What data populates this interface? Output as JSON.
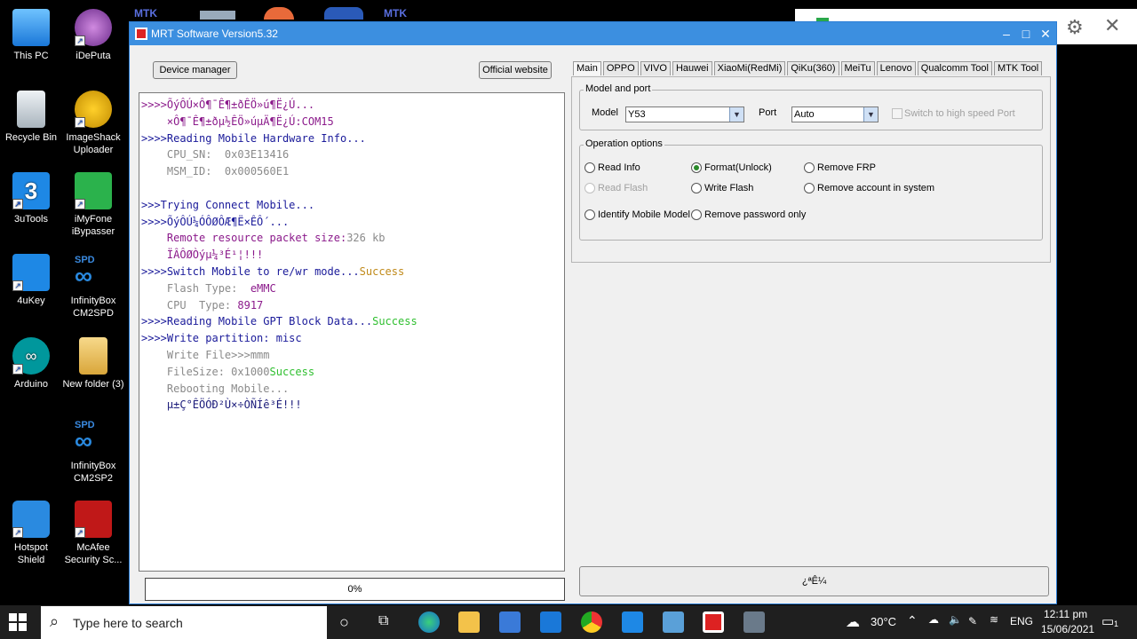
{
  "desktop": {
    "icons": [
      {
        "label": "This PC"
      },
      {
        "label": "iDePuta"
      },
      {
        "label": "Recycle Bin"
      },
      {
        "label": "ImageShack Uploader"
      },
      {
        "label": "3uTools"
      },
      {
        "label": "iMyFone iBypasser"
      },
      {
        "label": "4uKey"
      },
      {
        "label": "InfinityBox CM2SPD"
      },
      {
        "label": "Arduino"
      },
      {
        "label": "New folder (3)"
      },
      {
        "label": "InfinityBox CM2SP2"
      },
      {
        "label": "Hotspot Shield"
      },
      {
        "label": "McAfee Security Sc..."
      }
    ],
    "top_labels": [
      "MTK",
      "MTK"
    ],
    "spd_labels": [
      "SPD",
      "SPD"
    ]
  },
  "window": {
    "title": "MRT Software Version5.32",
    "device_manager_label": "Device manager",
    "official_website_label": "Official website",
    "progress_text": "0%",
    "bottom_button_text": "¿ªÊ¼"
  },
  "log": {
    "lines": [
      {
        "text": ">>>>ÕýÔÚ×Ô¶¯Ê¶±ðÊÖ»ú¶Ë¿Ú...",
        "cls": "c-purple"
      },
      {
        "text": "    ×Ô¶¯Ê¶±ðµ½ÊÖ»úµÄ¶Ë¿Ú:COM15",
        "cls": "c-purple"
      },
      {
        "text": ">>>>Reading Mobile Hardware Info...",
        "cls": "c-blue"
      },
      {
        "text": "    CPU_SN:  0x03E13416",
        "cls": "c-gray"
      },
      {
        "text": "    MSM_ID:  0x000560E1",
        "cls": "c-gray"
      },
      {
        "text": "",
        "cls": "c-gray"
      },
      {
        "text": ">>>Trying Connect Mobile...",
        "cls": "c-blue"
      },
      {
        "text": ">>>>ÕýÔÚ¼ÓÔØÔÆ¶Ë×ÊÔ´...",
        "cls": "c-blue"
      },
      {
        "text": "    Remote resource packet size:",
        "cls": "c-purple",
        "tail": "326 kb",
        "tailcls": "c-gray"
      },
      {
        "text": "    ÏÂÔØÒýµ¼³É¹¦!!!",
        "cls": "c-purple"
      },
      {
        "text": ">>>>Switch Mobile to re/wr mode...",
        "cls": "c-blue",
        "tail": "Success",
        "tailcls": "c-orange"
      },
      {
        "text": "    Flash Type:  ",
        "cls": "c-gray",
        "tail": "eMMC",
        "tailcls": "c-purple"
      },
      {
        "text": "    CPU  Type: ",
        "cls": "c-gray",
        "tail": "8917",
        "tailcls": "c-purple"
      },
      {
        "text": ">>>>Reading Mobile GPT Block Data...",
        "cls": "c-blue",
        "tail": "Success",
        "tailcls": "c-green"
      },
      {
        "text": ">>>>Write partition: misc",
        "cls": "c-blue"
      },
      {
        "text": "    Write File>>>mmm",
        "cls": "c-gray"
      },
      {
        "text": "    FileSize: 0x1000",
        "cls": "c-gray",
        "tail": "Success",
        "tailcls": "c-green"
      },
      {
        "text": "    Rebooting Mobile...",
        "cls": "c-gray"
      },
      {
        "text": "    µ±Ç°ÊÖÓÐ²Ù×÷ÒÑÍê³É!!!",
        "cls": "c-navy"
      }
    ]
  },
  "tabs": [
    "Main",
    "OPPO",
    "VIVO",
    "Hauwei",
    "XiaoMi(RedMi)",
    "QiKu(360)",
    "MeiTu",
    "Lenovo",
    "Qualcomm Tool",
    "MTK Tool"
  ],
  "model_port": {
    "group_title": "Model and port",
    "model_label": "Model",
    "model_value": "Y53",
    "port_label": "Port",
    "port_value": "Auto",
    "high_speed_label": "Switch to high speed Port"
  },
  "operation": {
    "group_title": "Operation options",
    "read_info": "Read Info",
    "format_unlock": "Format(Unlock)",
    "remove_frp": "Remove FRP",
    "read_flash": "Read Flash",
    "write_flash": "Write Flash",
    "remove_account": "Remove account in system",
    "identify_model": "Identify Mobile Model",
    "remove_password": "Remove password only",
    "selected": "Format(Unlock)"
  },
  "taskbar": {
    "search_placeholder": "Type here to search",
    "temperature": "30°C",
    "language": "ENG",
    "time": "12:11 pm",
    "date": "15/06/2021",
    "notification_count": "1"
  },
  "colors": {
    "titlebar": "#3c8fe0",
    "taskbar": "#1f1f1f",
    "success_green": "#2fbf2f"
  }
}
